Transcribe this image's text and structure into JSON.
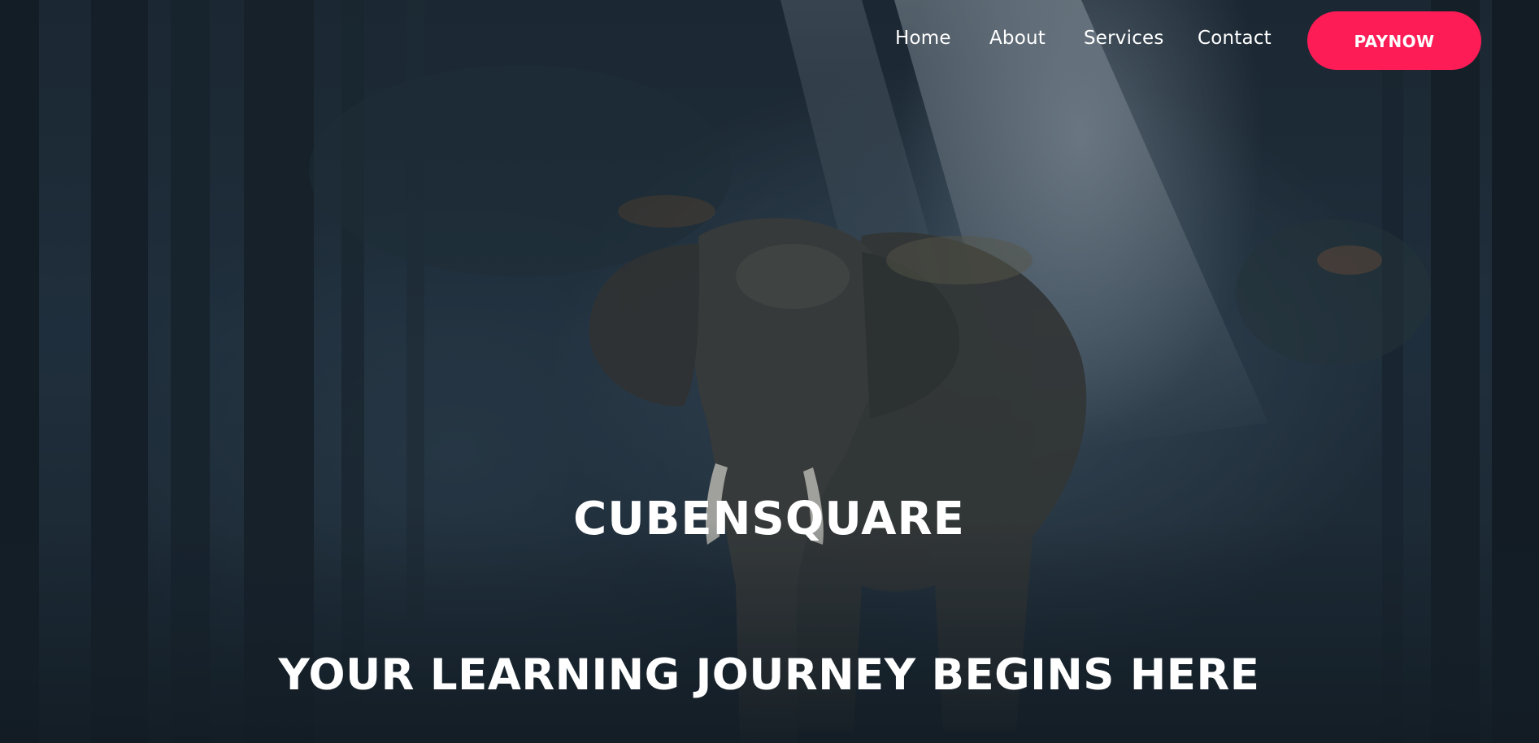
{
  "nav": {
    "links": [
      {
        "label": "Home"
      },
      {
        "label": "About"
      },
      {
        "label": "Services"
      },
      {
        "label": "Contact"
      }
    ],
    "cta_label": "PAYNOW"
  },
  "hero": {
    "title": "CUBENSQUARE",
    "tagline": "YOUR LEARNING JOURNEY BEGINS HERE",
    "background_image": "elephant-in-misty-forest"
  },
  "colors": {
    "accent": "#fe1c57",
    "text": "#ffffff",
    "background": "#1f2c38"
  }
}
